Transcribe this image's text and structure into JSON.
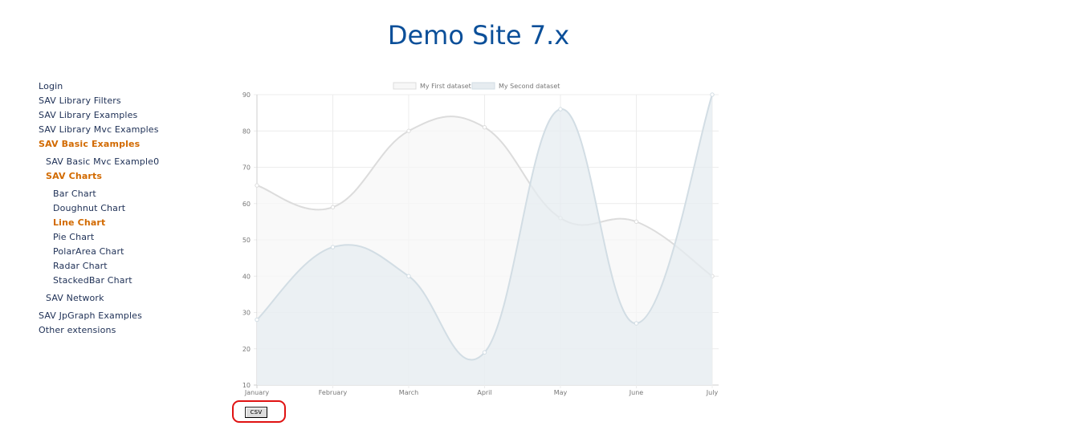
{
  "site": {
    "title": "Demo Site 7.x"
  },
  "nav": {
    "items": [
      {
        "label": "Login"
      },
      {
        "label": "SAV Library Filters"
      },
      {
        "label": "SAV Library Examples"
      },
      {
        "label": "SAV Library Mvc Examples"
      },
      {
        "label": "SAV Basic Examples"
      },
      {
        "label": "SAV Basic Mvc Example0"
      },
      {
        "label": "SAV Charts"
      },
      {
        "label": "Bar Chart"
      },
      {
        "label": "Doughnut Chart"
      },
      {
        "label": "Line Chart"
      },
      {
        "label": "Pie Chart"
      },
      {
        "label": "PolarArea Chart"
      },
      {
        "label": "Radar Chart"
      },
      {
        "label": "StackedBar Chart"
      },
      {
        "label": "SAV Network"
      },
      {
        "label": "SAV JpGraph Examples"
      },
      {
        "label": "Other extensions"
      }
    ],
    "active_color": "#d26a00",
    "link_color": "#1d2f55"
  },
  "chart_data": {
    "type": "area",
    "title": "",
    "xlabel": "",
    "ylabel": "",
    "categories": [
      "January",
      "February",
      "March",
      "April",
      "May",
      "June",
      "July"
    ],
    "ylim": [
      10,
      90
    ],
    "yticks": [
      10,
      20,
      30,
      40,
      50,
      60,
      70,
      80,
      90
    ],
    "grid": true,
    "legend_position": "top",
    "series": [
      {
        "name": "My First dataset",
        "values": [
          65,
          59,
          80,
          81,
          56,
          55,
          40
        ],
        "stroke": "#dcdcdc",
        "fill": "#f7f7f7"
      },
      {
        "name": "My Second dataset",
        "values": [
          28,
          48,
          40,
          19,
          86,
          27,
          90
        ],
        "stroke": "#d2dde4",
        "fill": "#e6ecf0"
      }
    ]
  },
  "csv_button": {
    "label": "csv"
  },
  "colors": {
    "title": "#0b4f99",
    "highlight": "#e01212"
  }
}
